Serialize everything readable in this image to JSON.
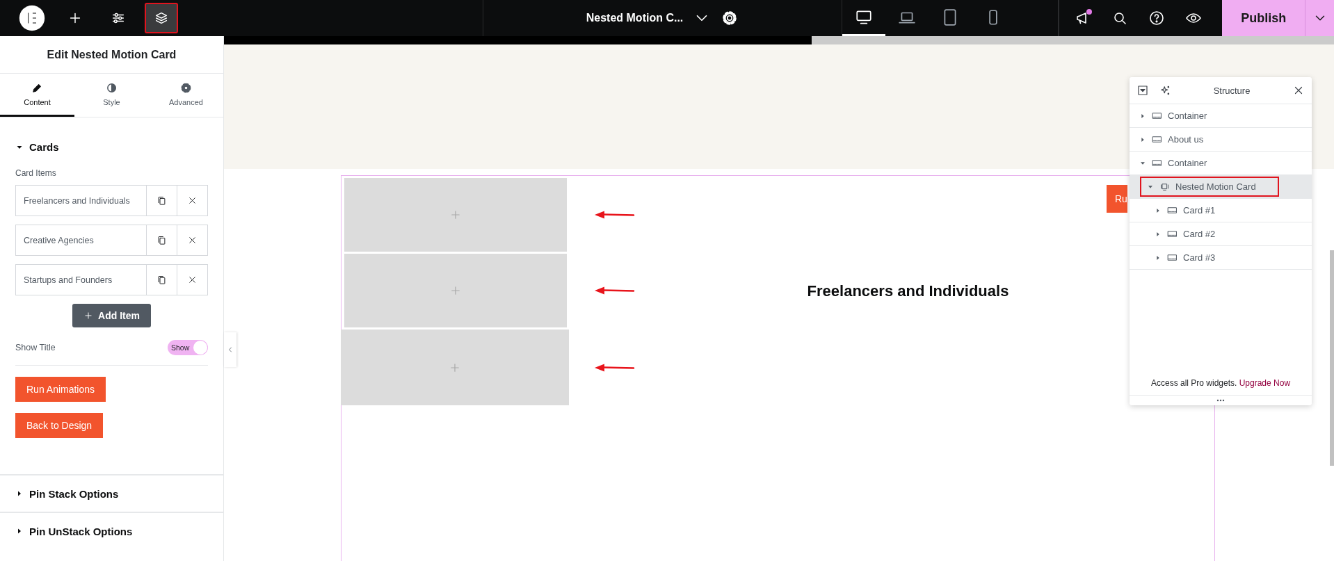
{
  "top_bar": {
    "tools": [
      {
        "kind": "logo",
        "highlighted": false
      },
      {
        "kind": "add",
        "highlighted": false
      },
      {
        "kind": "sliders",
        "highlighted": false
      },
      {
        "kind": "layers",
        "highlighted": true
      }
    ],
    "document": {
      "title": "Nested Motion C..."
    },
    "devices": [
      {
        "kind": "desktop",
        "selected": true
      },
      {
        "kind": "laptop",
        "selected": false
      },
      {
        "kind": "tablet",
        "selected": false
      },
      {
        "kind": "mobile",
        "selected": false
      }
    ],
    "actions": [
      {
        "kind": "megaphone",
        "unread": true
      },
      {
        "kind": "search",
        "unread": false
      },
      {
        "kind": "help",
        "unread": false
      },
      {
        "kind": "eye",
        "unread": false
      }
    ],
    "publish": {
      "label": "Publish"
    }
  },
  "panel": {
    "title": "Edit Nested Motion Card",
    "tabs": [
      {
        "label": "Content",
        "kind": "pencil",
        "selected": true
      },
      {
        "label": "Style",
        "kind": "contrast",
        "selected": false
      },
      {
        "label": "Advanced",
        "kind": "gear",
        "selected": false
      }
    ],
    "cards": {
      "title": "Cards",
      "expanded": true,
      "items_label": "Card Items",
      "items": [
        "Freelancers and Individuals",
        "Creative Agencies",
        "Startups and Founders"
      ],
      "add_label": "Add Item",
      "toggle": {
        "label": "Show Title",
        "on": true,
        "text": "Show"
      },
      "buttons": [
        "Run Animations",
        "Back to Design"
      ]
    },
    "sections": [
      {
        "title": "Pin Stack Options",
        "expanded": false
      },
      {
        "title": "Pin UnStack Options",
        "expanded": false
      }
    ]
  },
  "canvas": {
    "cards": [
      {
        "arrow": true
      },
      {
        "arrow": true
      },
      {
        "arrow": true
      }
    ],
    "title": "Freelancers and Individuals",
    "button": "Ru"
  },
  "structure": {
    "title": "Structure",
    "tree": [
      {
        "label": "Container",
        "kind": "container",
        "expanded": false,
        "selected": false,
        "highlighted": false
      },
      {
        "label": "About us",
        "kind": "container",
        "expanded": false,
        "selected": false,
        "highlighted": false
      },
      {
        "label": "Container",
        "kind": "container",
        "expanded": true,
        "selected": false,
        "highlighted": false,
        "children": [
          {
            "label": "Nested Motion Card",
            "kind": "widget",
            "expanded": true,
            "selected": true,
            "highlighted": true,
            "children": [
              {
                "label": "Card #1",
                "kind": "container",
                "expanded": false,
                "selected": false,
                "highlighted": false
              },
              {
                "label": "Card #2",
                "kind": "container",
                "expanded": false,
                "selected": false,
                "highlighted": false
              },
              {
                "label": "Card #3",
                "kind": "container",
                "expanded": false,
                "selected": false,
                "highlighted": false
              }
            ]
          }
        ]
      }
    ],
    "footer": {
      "text": "Access all Pro widgets.",
      "link": "Upgrade Now"
    }
  }
}
